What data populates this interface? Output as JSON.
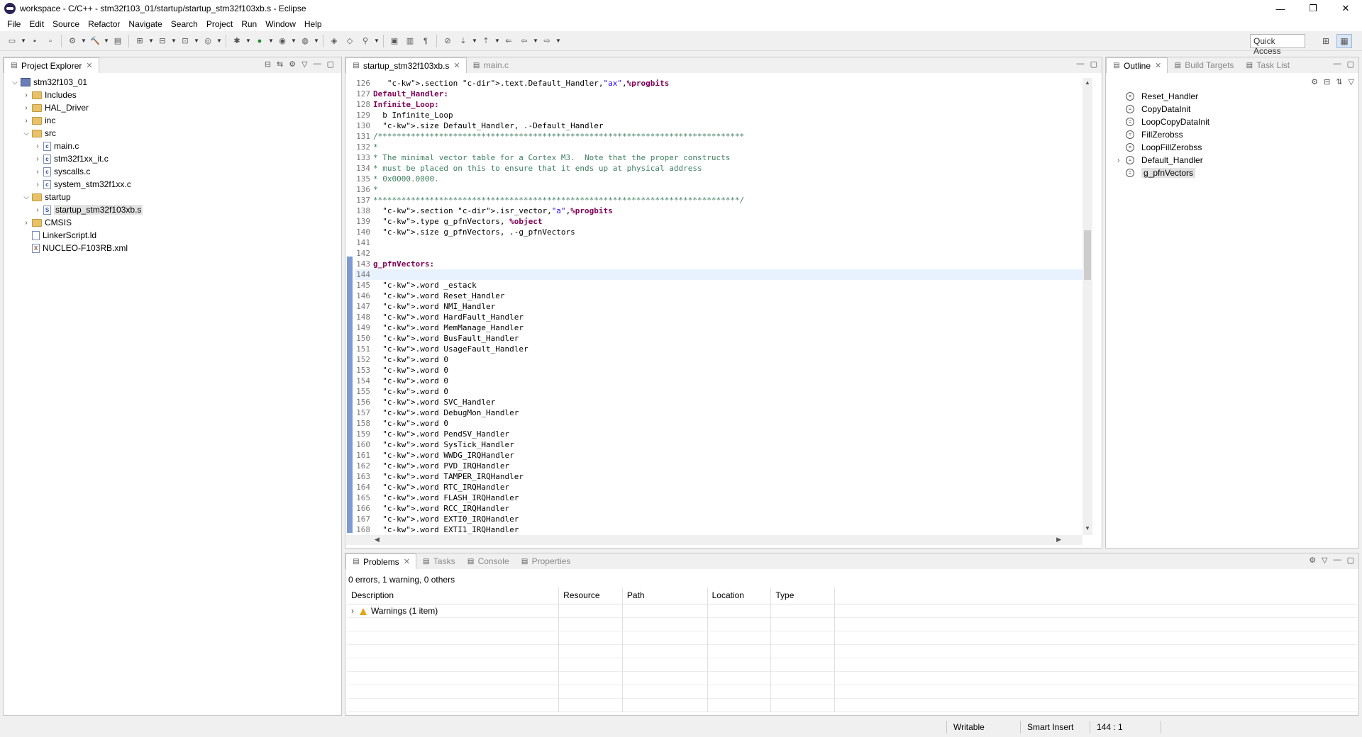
{
  "window": {
    "title": "workspace - C/C++ - stm32f103_01/startup/startup_stm32f103xb.s - Eclipse",
    "minimize": "—",
    "restore": "❐",
    "close": "✕"
  },
  "menu": [
    "File",
    "Edit",
    "Source",
    "Refactor",
    "Navigate",
    "Search",
    "Project",
    "Run",
    "Window",
    "Help"
  ],
  "toolbar": {
    "quick_access": "Quick Access"
  },
  "project_explorer": {
    "tab_label": "Project Explorer",
    "tree": [
      {
        "label": "stm32f103_01",
        "icon": "project",
        "twisty": "open",
        "indent": 0
      },
      {
        "label": "Includes",
        "icon": "folder",
        "twisty": "closed",
        "indent": 1
      },
      {
        "label": "HAL_Driver",
        "icon": "folder",
        "twisty": "closed",
        "indent": 1
      },
      {
        "label": "inc",
        "icon": "folder",
        "twisty": "closed",
        "indent": 1
      },
      {
        "label": "src",
        "icon": "folder",
        "twisty": "open",
        "indent": 1
      },
      {
        "label": "main.c",
        "icon": "c-file",
        "twisty": "closed",
        "indent": 2
      },
      {
        "label": "stm32f1xx_it.c",
        "icon": "c-file",
        "twisty": "closed",
        "indent": 2
      },
      {
        "label": "syscalls.c",
        "icon": "c-file",
        "twisty": "closed",
        "indent": 2
      },
      {
        "label": "system_stm32f1xx.c",
        "icon": "c-file",
        "twisty": "closed",
        "indent": 2
      },
      {
        "label": "startup",
        "icon": "folder",
        "twisty": "open",
        "indent": 1
      },
      {
        "label": "startup_stm32f103xb.s",
        "icon": "s-file",
        "twisty": "closed",
        "indent": 2,
        "selected": true
      },
      {
        "label": "CMSIS",
        "icon": "folder",
        "twisty": "closed",
        "indent": 1
      },
      {
        "label": "LinkerScript.ld",
        "icon": "ld-file",
        "twisty": "none",
        "indent": 1
      },
      {
        "label": "NUCLEO-F103RB.xml",
        "icon": "x-file",
        "twisty": "none",
        "indent": 1
      }
    ]
  },
  "editor": {
    "tabs": [
      {
        "label": "startup_stm32f103xb.s",
        "active": true
      },
      {
        "label": "main.c",
        "active": false
      }
    ],
    "lines": [
      {
        "n": "126",
        "text": "   .section .text.Default_Handler,\"ax\",%progbits",
        "kind": "dir"
      },
      {
        "n": "127",
        "text": "Default_Handler:",
        "kind": "lbl"
      },
      {
        "n": "128",
        "text": "Infinite_Loop:",
        "kind": "lbl"
      },
      {
        "n": "129",
        "text": "  b Infinite_Loop",
        "kind": "plain"
      },
      {
        "n": "130",
        "text": "  .size Default_Handler, .-Default_Handler",
        "kind": "dir"
      },
      {
        "n": "131",
        "text": "/******************************************************************************",
        "kind": "com"
      },
      {
        "n": "132",
        "text": "*",
        "kind": "com"
      },
      {
        "n": "133",
        "text": "* The minimal vector table for a Cortex M3.  Note that the proper constructs",
        "kind": "com"
      },
      {
        "n": "134",
        "text": "* must be placed on this to ensure that it ends up at physical address",
        "kind": "com"
      },
      {
        "n": "135",
        "text": "* 0x0000.0000.",
        "kind": "com"
      },
      {
        "n": "136",
        "text": "*",
        "kind": "com"
      },
      {
        "n": "137",
        "text": "******************************************************************************/",
        "kind": "com"
      },
      {
        "n": "138",
        "text": "  .section .isr_vector,\"a\",%progbits",
        "kind": "dir"
      },
      {
        "n": "139",
        "text": "  .type g_pfnVectors, %object",
        "kind": "dir"
      },
      {
        "n": "140",
        "text": "  .size g_pfnVectors, .-g_pfnVectors",
        "kind": "dir"
      },
      {
        "n": "141",
        "text": "",
        "kind": "plain"
      },
      {
        "n": "142",
        "text": "",
        "kind": "plain"
      },
      {
        "n": "143",
        "text": "g_pfnVectors:",
        "kind": "lbl"
      },
      {
        "n": "144",
        "text": "",
        "kind": "plain",
        "current": true
      },
      {
        "n": "145",
        "text": "  .word _estack",
        "kind": "word"
      },
      {
        "n": "146",
        "text": "  .word Reset_Handler",
        "kind": "word"
      },
      {
        "n": "147",
        "text": "  .word NMI_Handler",
        "kind": "word"
      },
      {
        "n": "148",
        "text": "  .word HardFault_Handler",
        "kind": "word"
      },
      {
        "n": "149",
        "text": "  .word MemManage_Handler",
        "kind": "word"
      },
      {
        "n": "150",
        "text": "  .word BusFault_Handler",
        "kind": "word"
      },
      {
        "n": "151",
        "text": "  .word UsageFault_Handler",
        "kind": "word"
      },
      {
        "n": "152",
        "text": "  .word 0",
        "kind": "word"
      },
      {
        "n": "153",
        "text": "  .word 0",
        "kind": "word"
      },
      {
        "n": "154",
        "text": "  .word 0",
        "kind": "word"
      },
      {
        "n": "155",
        "text": "  .word 0",
        "kind": "word"
      },
      {
        "n": "156",
        "text": "  .word SVC_Handler",
        "kind": "word"
      },
      {
        "n": "157",
        "text": "  .word DebugMon_Handler",
        "kind": "word"
      },
      {
        "n": "158",
        "text": "  .word 0",
        "kind": "word"
      },
      {
        "n": "159",
        "text": "  .word PendSV_Handler",
        "kind": "word"
      },
      {
        "n": "160",
        "text": "  .word SysTick_Handler",
        "kind": "word"
      },
      {
        "n": "161",
        "text": "  .word WWDG_IRQHandler",
        "kind": "word"
      },
      {
        "n": "162",
        "text": "  .word PVD_IRQHandler",
        "kind": "word"
      },
      {
        "n": "163",
        "text": "  .word TAMPER_IRQHandler",
        "kind": "word"
      },
      {
        "n": "164",
        "text": "  .word RTC_IRQHandler",
        "kind": "word"
      },
      {
        "n": "165",
        "text": "  .word FLASH_IRQHandler",
        "kind": "word"
      },
      {
        "n": "166",
        "text": "  .word RCC_IRQHandler",
        "kind": "word"
      },
      {
        "n": "167",
        "text": "  .word EXTI0_IRQHandler",
        "kind": "word"
      },
      {
        "n": "168",
        "text": "  .word EXTI1_IRQHandler",
        "kind": "word"
      }
    ]
  },
  "outline": {
    "tabs": [
      {
        "label": "Outline",
        "active": true
      },
      {
        "label": "Build Targets",
        "active": false
      },
      {
        "label": "Task List",
        "active": false
      }
    ],
    "items": [
      {
        "label": "Reset_Handler",
        "twisty": false
      },
      {
        "label": "CopyDataInit",
        "twisty": false
      },
      {
        "label": "LoopCopyDataInit",
        "twisty": false
      },
      {
        "label": "FillZerobss",
        "twisty": false
      },
      {
        "label": "LoopFillZerobss",
        "twisty": false
      },
      {
        "label": "Default_Handler",
        "twisty": true
      },
      {
        "label": "g_pfnVectors",
        "twisty": false,
        "selected": true
      }
    ]
  },
  "problems": {
    "tabs": [
      {
        "label": "Problems",
        "active": true
      },
      {
        "label": "Tasks",
        "active": false
      },
      {
        "label": "Console",
        "active": false
      },
      {
        "label": "Properties",
        "active": false
      }
    ],
    "summary": "0 errors, 1 warning, 0 others",
    "columns": [
      "Description",
      "Resource",
      "Path",
      "Location",
      "Type"
    ],
    "rows": [
      {
        "description": "Warnings (1 item)"
      }
    ]
  },
  "status": {
    "writable": "Writable",
    "insert_mode": "Smart Insert",
    "position": "144 : 1"
  }
}
